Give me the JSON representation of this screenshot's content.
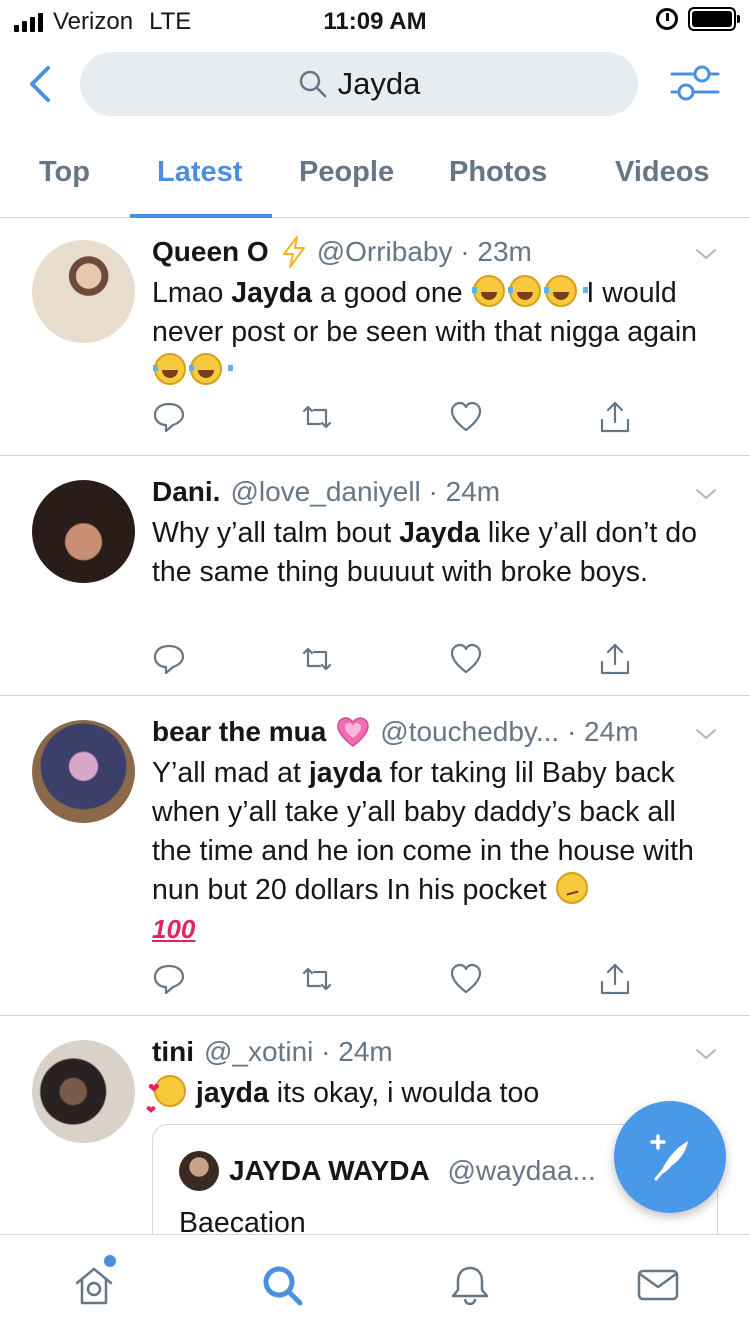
{
  "status_bar": {
    "carrier": "Verizon",
    "network": "LTE",
    "time": "11:09 AM"
  },
  "search": {
    "query": "Jayda",
    "icon": "search-icon"
  },
  "tabs": [
    {
      "label": "Top"
    },
    {
      "label": "Latest"
    },
    {
      "label": "People"
    },
    {
      "label": "Photos"
    },
    {
      "label": "Videos"
    }
  ],
  "tweets": [
    {
      "name": "Queen O",
      "handle": "@Orribaby · 23m",
      "text_a": "Lmao ",
      "text_bold": "Jayda",
      "text_b": " a good one",
      "text_c": " I would never post or be seen with that nigga again"
    },
    {
      "name": "Dani.",
      "handle": "@love_daniyell · 24m",
      "text_a": "Why y’all talm bout ",
      "text_bold": "Jayda",
      "text_b": " like y’all don’t do the same thing buuuut with broke boys."
    },
    {
      "name": "bear the mua",
      "handle": "@touchedby... · 24m",
      "text_a": "Y’all mad at ",
      "text_bold": "jayda",
      "text_b": " for taking lil Baby back when y’all take y’all baby daddy’s back all the time and he ion come in the house with nun but 20 dollars In his pocket",
      "emoji_hundred": "100"
    },
    {
      "name": "tini",
      "handle": "@_xotini · 24m",
      "text_bold": "jayda",
      "text_b": " its okay, i woulda too",
      "quote": {
        "name": "JAYDA WAYDA",
        "handle": "@waydaa...",
        "text": "Baecation"
      }
    }
  ],
  "colors": {
    "accent": "#4a90e2",
    "secondary_text": "#657786",
    "divider": "#cfd9de"
  },
  "bottom_nav": [
    "home-icon",
    "search-icon",
    "notifications-icon",
    "messages-icon"
  ]
}
